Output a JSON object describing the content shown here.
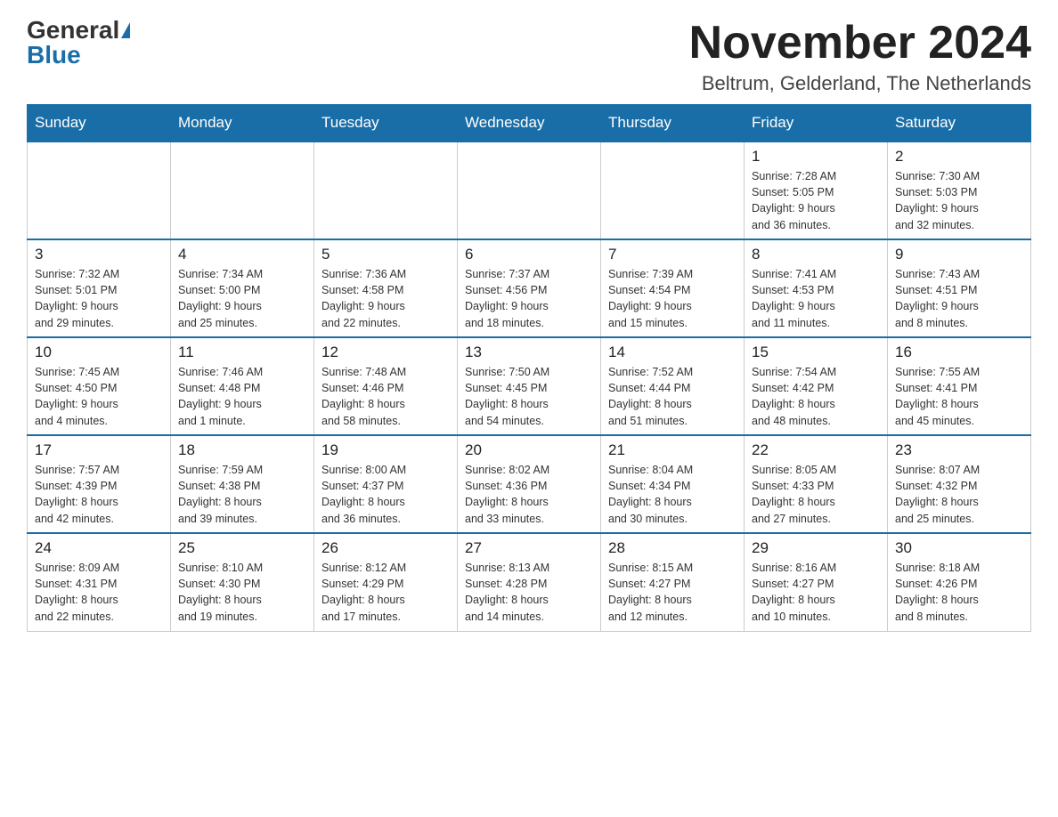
{
  "logo": {
    "general": "General",
    "blue": "Blue"
  },
  "title": "November 2024",
  "subtitle": "Beltrum, Gelderland, The Netherlands",
  "weekdays": [
    "Sunday",
    "Monday",
    "Tuesday",
    "Wednesday",
    "Thursday",
    "Friday",
    "Saturday"
  ],
  "weeks": [
    [
      {
        "day": "",
        "info": ""
      },
      {
        "day": "",
        "info": ""
      },
      {
        "day": "",
        "info": ""
      },
      {
        "day": "",
        "info": ""
      },
      {
        "day": "",
        "info": ""
      },
      {
        "day": "1",
        "info": "Sunrise: 7:28 AM\nSunset: 5:05 PM\nDaylight: 9 hours\nand 36 minutes."
      },
      {
        "day": "2",
        "info": "Sunrise: 7:30 AM\nSunset: 5:03 PM\nDaylight: 9 hours\nand 32 minutes."
      }
    ],
    [
      {
        "day": "3",
        "info": "Sunrise: 7:32 AM\nSunset: 5:01 PM\nDaylight: 9 hours\nand 29 minutes."
      },
      {
        "day": "4",
        "info": "Sunrise: 7:34 AM\nSunset: 5:00 PM\nDaylight: 9 hours\nand 25 minutes."
      },
      {
        "day": "5",
        "info": "Sunrise: 7:36 AM\nSunset: 4:58 PM\nDaylight: 9 hours\nand 22 minutes."
      },
      {
        "day": "6",
        "info": "Sunrise: 7:37 AM\nSunset: 4:56 PM\nDaylight: 9 hours\nand 18 minutes."
      },
      {
        "day": "7",
        "info": "Sunrise: 7:39 AM\nSunset: 4:54 PM\nDaylight: 9 hours\nand 15 minutes."
      },
      {
        "day": "8",
        "info": "Sunrise: 7:41 AM\nSunset: 4:53 PM\nDaylight: 9 hours\nand 11 minutes."
      },
      {
        "day": "9",
        "info": "Sunrise: 7:43 AM\nSunset: 4:51 PM\nDaylight: 9 hours\nand 8 minutes."
      }
    ],
    [
      {
        "day": "10",
        "info": "Sunrise: 7:45 AM\nSunset: 4:50 PM\nDaylight: 9 hours\nand 4 minutes."
      },
      {
        "day": "11",
        "info": "Sunrise: 7:46 AM\nSunset: 4:48 PM\nDaylight: 9 hours\nand 1 minute."
      },
      {
        "day": "12",
        "info": "Sunrise: 7:48 AM\nSunset: 4:46 PM\nDaylight: 8 hours\nand 58 minutes."
      },
      {
        "day": "13",
        "info": "Sunrise: 7:50 AM\nSunset: 4:45 PM\nDaylight: 8 hours\nand 54 minutes."
      },
      {
        "day": "14",
        "info": "Sunrise: 7:52 AM\nSunset: 4:44 PM\nDaylight: 8 hours\nand 51 minutes."
      },
      {
        "day": "15",
        "info": "Sunrise: 7:54 AM\nSunset: 4:42 PM\nDaylight: 8 hours\nand 48 minutes."
      },
      {
        "day": "16",
        "info": "Sunrise: 7:55 AM\nSunset: 4:41 PM\nDaylight: 8 hours\nand 45 minutes."
      }
    ],
    [
      {
        "day": "17",
        "info": "Sunrise: 7:57 AM\nSunset: 4:39 PM\nDaylight: 8 hours\nand 42 minutes."
      },
      {
        "day": "18",
        "info": "Sunrise: 7:59 AM\nSunset: 4:38 PM\nDaylight: 8 hours\nand 39 minutes."
      },
      {
        "day": "19",
        "info": "Sunrise: 8:00 AM\nSunset: 4:37 PM\nDaylight: 8 hours\nand 36 minutes."
      },
      {
        "day": "20",
        "info": "Sunrise: 8:02 AM\nSunset: 4:36 PM\nDaylight: 8 hours\nand 33 minutes."
      },
      {
        "day": "21",
        "info": "Sunrise: 8:04 AM\nSunset: 4:34 PM\nDaylight: 8 hours\nand 30 minutes."
      },
      {
        "day": "22",
        "info": "Sunrise: 8:05 AM\nSunset: 4:33 PM\nDaylight: 8 hours\nand 27 minutes."
      },
      {
        "day": "23",
        "info": "Sunrise: 8:07 AM\nSunset: 4:32 PM\nDaylight: 8 hours\nand 25 minutes."
      }
    ],
    [
      {
        "day": "24",
        "info": "Sunrise: 8:09 AM\nSunset: 4:31 PM\nDaylight: 8 hours\nand 22 minutes."
      },
      {
        "day": "25",
        "info": "Sunrise: 8:10 AM\nSunset: 4:30 PM\nDaylight: 8 hours\nand 19 minutes."
      },
      {
        "day": "26",
        "info": "Sunrise: 8:12 AM\nSunset: 4:29 PM\nDaylight: 8 hours\nand 17 minutes."
      },
      {
        "day": "27",
        "info": "Sunrise: 8:13 AM\nSunset: 4:28 PM\nDaylight: 8 hours\nand 14 minutes."
      },
      {
        "day": "28",
        "info": "Sunrise: 8:15 AM\nSunset: 4:27 PM\nDaylight: 8 hours\nand 12 minutes."
      },
      {
        "day": "29",
        "info": "Sunrise: 8:16 AM\nSunset: 4:27 PM\nDaylight: 8 hours\nand 10 minutes."
      },
      {
        "day": "30",
        "info": "Sunrise: 8:18 AM\nSunset: 4:26 PM\nDaylight: 8 hours\nand 8 minutes."
      }
    ]
  ]
}
